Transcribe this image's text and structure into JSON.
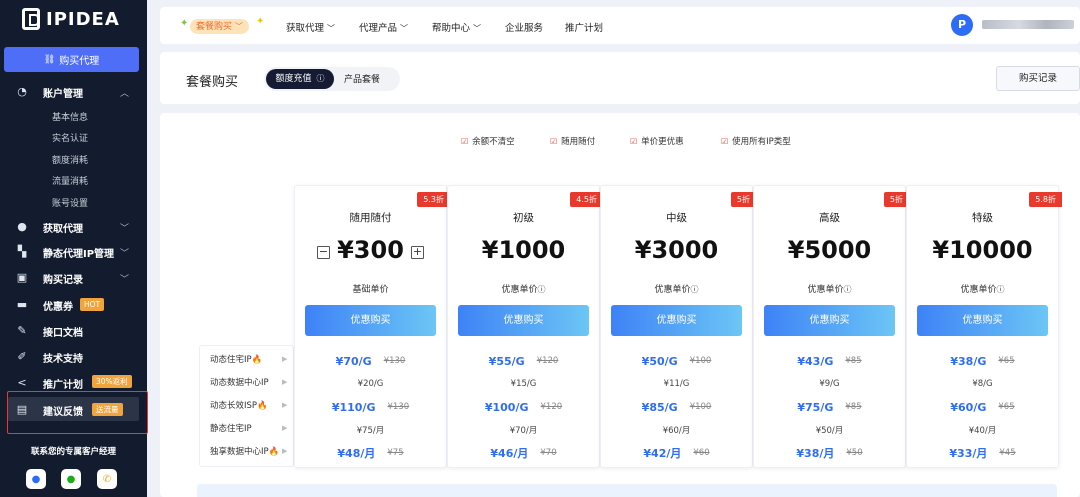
{
  "brand": {
    "name": "IPIDEA"
  },
  "sidebar": {
    "buy_button": "购买代理",
    "account": {
      "label": "账户管理",
      "subitems": [
        "基本信息",
        "实名认证",
        "额度消耗",
        "流量消耗",
        "账号设置"
      ]
    },
    "items": [
      {
        "label": "获取代理",
        "icon": "user-icon"
      },
      {
        "label": "静态代理IP管理",
        "icon": "proxy-icon"
      },
      {
        "label": "购买记录",
        "icon": "bag-icon"
      },
      {
        "label": "优惠券",
        "icon": "ticket-icon",
        "badge": "HOT"
      },
      {
        "label": "接口文档",
        "icon": "doc-icon"
      },
      {
        "label": "技术支持",
        "icon": "edit-icon"
      },
      {
        "label": "推广计划",
        "icon": "share-icon",
        "badge": "30%返利"
      },
      {
        "label": "建议反馈",
        "icon": "feedback-icon",
        "badge": "送流量"
      }
    ],
    "contact_label": "联系您的专属客户经理"
  },
  "topbar": {
    "promo": "套餐购买",
    "nav": [
      "获取代理",
      "代理产品",
      "帮助中心",
      "企业服务",
      "推广计划"
    ]
  },
  "header": {
    "title": "套餐购买",
    "tabs": [
      "额度充值",
      "产品套餐"
    ],
    "records_button": "购买记录"
  },
  "features": [
    "余额不清空",
    "随用随付",
    "单价更优惠",
    "使用所有IP类型"
  ],
  "row_labels": [
    "动态住宅IP",
    "动态数据中心IP",
    "动态长效ISP",
    "静态住宅IP",
    "独享数据中心IP"
  ],
  "plans": [
    {
      "name": "随用随付",
      "discount": "5.3折",
      "price": "¥300",
      "note": "基础单价",
      "button": "优惠购买",
      "rows": [
        {
          "p": "¥70/G",
          "o": "¥130"
        },
        {
          "p": "¥20/G"
        },
        {
          "p": "¥110/G",
          "o": "¥130"
        },
        {
          "p": "¥75/月"
        },
        {
          "p": "¥48/月",
          "o": "¥75"
        }
      ]
    },
    {
      "name": "初级",
      "discount": "4.5折",
      "price": "¥1000",
      "note": "优惠单价",
      "button": "优惠购买",
      "rows": [
        {
          "p": "¥55/G",
          "o": "¥120"
        },
        {
          "p": "¥15/G"
        },
        {
          "p": "¥100/G",
          "o": "¥120"
        },
        {
          "p": "¥70/月"
        },
        {
          "p": "¥46/月",
          "o": "¥70"
        }
      ]
    },
    {
      "name": "中级",
      "discount": "5折",
      "price": "¥3000",
      "note": "优惠单价",
      "button": "优惠购买",
      "rows": [
        {
          "p": "¥50/G",
          "o": "¥100"
        },
        {
          "p": "¥11/G"
        },
        {
          "p": "¥85/G",
          "o": "¥100"
        },
        {
          "p": "¥60/月"
        },
        {
          "p": "¥42/月",
          "o": "¥60"
        }
      ]
    },
    {
      "name": "高级",
      "discount": "5折",
      "price": "¥5000",
      "note": "优惠单价",
      "button": "优惠购买",
      "rows": [
        {
          "p": "¥43/G",
          "o": "¥85"
        },
        {
          "p": "¥9/G"
        },
        {
          "p": "¥75/G",
          "o": "¥85"
        },
        {
          "p": "¥50/月"
        },
        {
          "p": "¥38/月",
          "o": "¥50"
        }
      ]
    },
    {
      "name": "特级",
      "discount": "5.8折",
      "price": "¥10000",
      "note": "优惠单价",
      "button": "优惠购买",
      "rows": [
        {
          "p": "¥38/G",
          "o": "¥65"
        },
        {
          "p": "¥8/G"
        },
        {
          "p": "¥60/G",
          "o": "¥65"
        },
        {
          "p": "¥40/月"
        },
        {
          "p": "¥33/月",
          "o": "¥45"
        }
      ]
    }
  ]
}
